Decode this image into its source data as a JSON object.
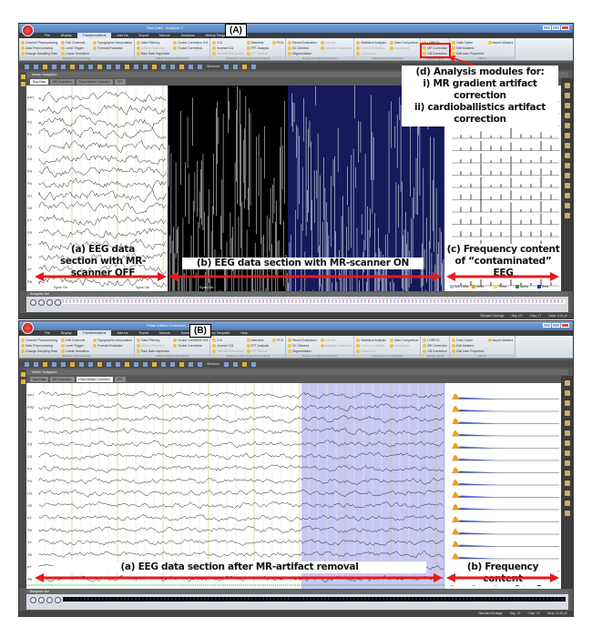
{
  "panels": [
    {
      "id_label": "(A)",
      "title": "Raw Data - Analyzer 2",
      "menu": [
        "File",
        "Display",
        "Transformations",
        "Add Ins",
        "Export",
        "Macros",
        "Solutions",
        "History Template",
        "Help"
      ],
      "active_menu": "Transformations",
      "ribbon_groups": [
        {
          "label": "Dataset Preprocessing",
          "items": [
            "Channel Preprocessing",
            "Data Preprocessing",
            "Change Sampling Rate",
            "Edit Channels",
            "Level Trigger",
            "Linear Derivation",
            "Topographic Interpolation",
            "Formula Evaluator"
          ]
        },
        {
          "label": "Artifact Rejection/Reduction",
          "items": [
            "Data Filtering",
            "Artifact Rejection",
            "Raw Data Inspection",
            "Ocular Correction ICA",
            "Ocular Correction"
          ]
        },
        {
          "label": "Frequency and Component Analysis",
          "items": [
            "ICA",
            "Inverse ICA",
            "Wavelet Extraction",
            "Wavelets",
            "FFT Analysis",
            "FFT Inverse",
            "PCA"
          ]
        },
        {
          "label": "Segment Analysis Functions",
          "items": [
            "Result Evaluation",
            "DC Detrend",
            "Segmentation",
            "Average",
            "Baseline Correction"
          ]
        },
        {
          "label": "Comparison and Statistics",
          "items": [
            "Statistical Analysis",
            "Cross Correlation",
            "Coherence",
            "Data Comparison",
            "Covariance"
          ]
        },
        {
          "label": "Special Signal Processing",
          "items": [
            "LORETA",
            "MR Correction",
            "CB Correction"
          ]
        },
        {
          "label": "Others",
          "items": [
            "Data Cache",
            "Edit Markers",
            "Edit User Properties",
            "Import Markers"
          ]
        }
      ],
      "toolbar_windows_label": "Windows",
      "marker_nav_label": "Marker Navigation",
      "tabs": [
        "Raw Data",
        "MR Correction",
        "Pulse Artifact Correction",
        "FFT"
      ],
      "active_tab": "Raw Data",
      "nav_bar_label": "Navigation Bar",
      "status": [
        "Standard Montage",
        "Seg: 1/1",
        "Chan: 17",
        "Value: 0.00 µV"
      ],
      "markers": [
        "Sync On",
        "Sync On",
        "Sync On"
      ]
    },
    {
      "id_label": "(B)",
      "title": "Pulse Artifact Correction - Analyzer 2",
      "menu": [
        "File",
        "Display",
        "Transformations",
        "Add Ins",
        "Export",
        "Macros",
        "Solutions",
        "History Template",
        "Help"
      ],
      "active_menu": "Transformations",
      "ribbon_groups": [
        {
          "label": "Dataset Preprocessing",
          "items": [
            "Channel Preprocessing",
            "Data Preprocessing",
            "Change Sampling Rate",
            "Edit Channels",
            "Level Trigger",
            "Linear Derivation",
            "Topographic Interpolation",
            "Formula Evaluator"
          ]
        },
        {
          "label": "Artifact Rejection/Reduction",
          "items": [
            "Data Filtering",
            "Artifact Rejection",
            "Raw Data Inspection",
            "Ocular Correction ICA",
            "Ocular Correction"
          ]
        },
        {
          "label": "Frequency and Component Analysis",
          "items": [
            "ICA",
            "Inverse ICA",
            "Wavelet Extraction",
            "Wavelets",
            "FFT Analysis",
            "FFT Inverse",
            "PCA"
          ]
        },
        {
          "label": "Segment Analysis Functions",
          "items": [
            "Result Evaluation",
            "DC Detrend",
            "Segmentation",
            "Average",
            "Baseline Correction"
          ]
        },
        {
          "label": "Comparison and Statistics",
          "items": [
            "Statistical Analysis",
            "Cross Correlation",
            "Coherence",
            "Data Comparison",
            "Covariance"
          ]
        },
        {
          "label": "Special Signal Processing",
          "items": [
            "LORETA",
            "MR Correction",
            "CB Correction"
          ]
        },
        {
          "label": "Others",
          "items": [
            "Data Cache",
            "Edit Markers",
            "Edit User Properties",
            "Import Markers"
          ]
        }
      ],
      "toolbar_windows_label": "Windows",
      "marker_nav_label": "Marker Navigation",
      "tabs": [
        "Raw Data",
        "MR Correction",
        "Pulse Artifact Correction",
        "FFT"
      ],
      "active_tab": "Pulse Artifact Correction",
      "nav_bar_label": "Navigation Bar",
      "status": [
        "Standard Montage",
        "Seg: 1/1",
        "Chan: 19",
        "Value: 24.26 µV"
      ],
      "markers": []
    }
  ],
  "channels": [
    "FP1",
    "FP2",
    "F3",
    "F4",
    "C3",
    "C4",
    "P3",
    "P4",
    "O1",
    "O2",
    "F7",
    "F8",
    "T7",
    "T8",
    "P7",
    "P8"
  ],
  "freq_legend": [
    "Sub Delta",
    "Delta",
    "Theta",
    "Alpha",
    "Beta"
  ],
  "freq_legend_colors": [
    "#9fc3e8",
    "#e8a020",
    "#f0e020",
    "#20a020",
    "#1030d0"
  ],
  "annotations": {
    "a_top": "(a) EEG data section with MR-scanner OFF",
    "b_top": "(b) EEG data section with MR-scanner ON",
    "c_top": "(c) Frequency content of “contaminated” EEG",
    "d_top_title": "(d) Analysis modules for:",
    "d_top_i": "i) MR gradient artifact correction",
    "d_top_ii": "ii) cardioballistics artifact correction",
    "a_bottom": "(a) EEG data section after MR-artifact removal",
    "b_bottom": "(b) Frequency content"
  },
  "colors": {
    "annotation_red": "#e8191a",
    "scanner_on_dark": "#000000",
    "scanner_on_navy": "#141a5a",
    "corrected_highlight": "#c8c8f4"
  }
}
